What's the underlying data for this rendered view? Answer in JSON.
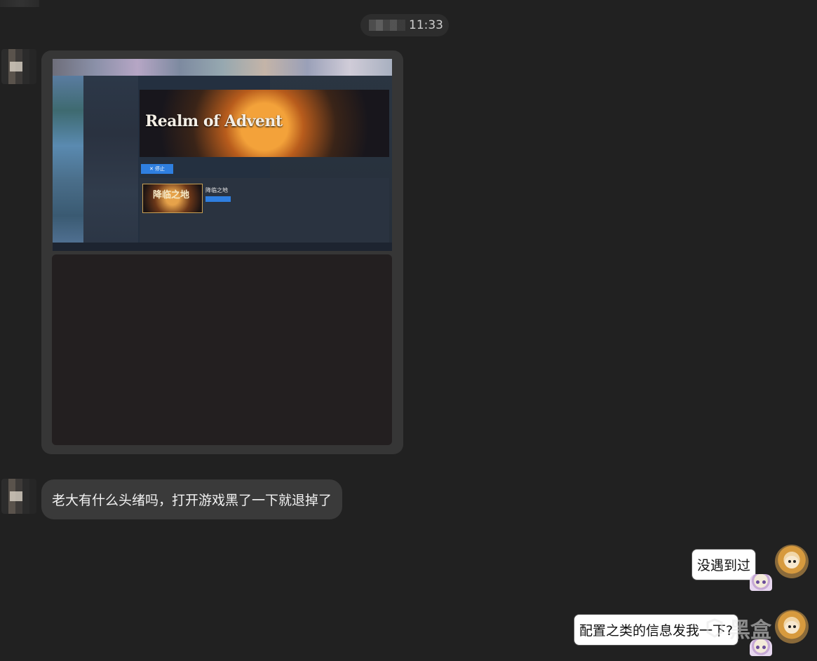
{
  "timestamp": {
    "time": "11:33"
  },
  "incoming_image": {
    "banner_title": "Realm of Advent",
    "stop_button": "✕ 停止",
    "game_thumb_text": "降临之地",
    "game_name": "降临之地"
  },
  "messages": [
    {
      "side": "left",
      "text": "老大有什么头绪吗，打开游戏黑了一下就退掉了"
    },
    {
      "side": "right",
      "text": "没遇到过"
    },
    {
      "side": "right",
      "text": "配置之类的信息发我一下?"
    }
  ],
  "watermark": {
    "text": "黑盒"
  }
}
